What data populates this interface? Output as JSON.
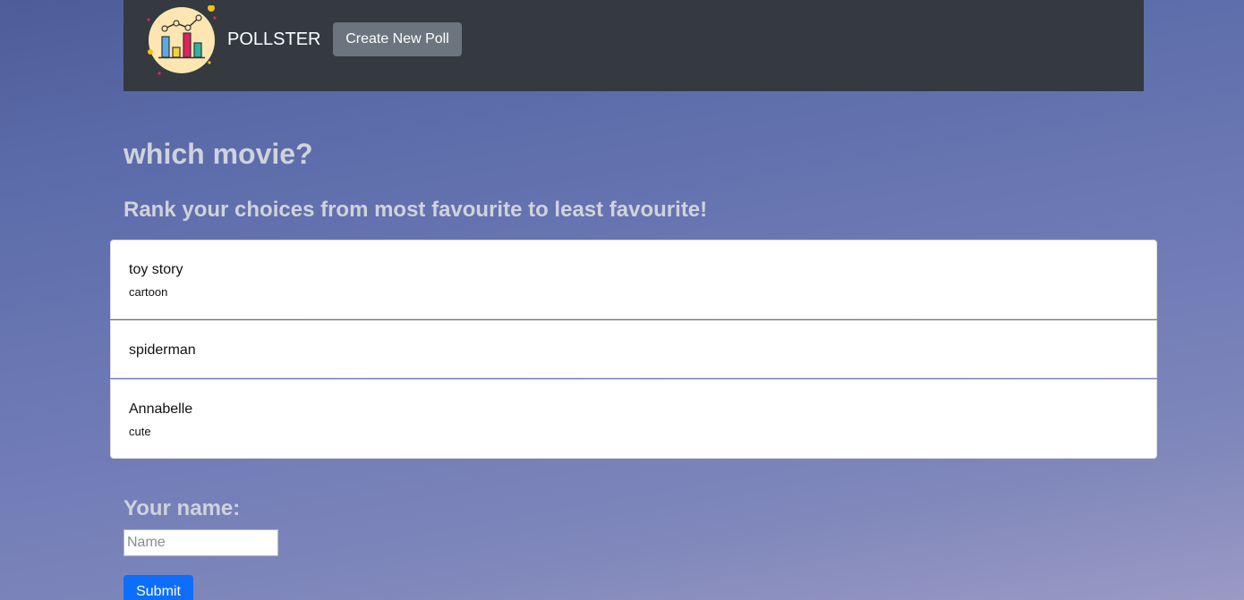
{
  "navbar": {
    "logo_icon": "bar-chart-icon",
    "brand": "POLLSTER",
    "create_button_label": "Create New Poll",
    "background": "#343a40"
  },
  "poll": {
    "title": "which movie?",
    "instructions": "Rank your choices from most favourite to least favourite!",
    "choices": [
      {
        "name": "toy story",
        "description": "cartoon"
      },
      {
        "name": "spiderman",
        "description": ""
      },
      {
        "name": "Annabelle",
        "description": "cute"
      }
    ]
  },
  "form": {
    "name_label": "Your name:",
    "name_value": "",
    "name_placeholder": "Name",
    "submit_label": "Submit"
  },
  "colors": {
    "secondary_button": "#6c757d",
    "primary_button": "#0d6efd"
  }
}
